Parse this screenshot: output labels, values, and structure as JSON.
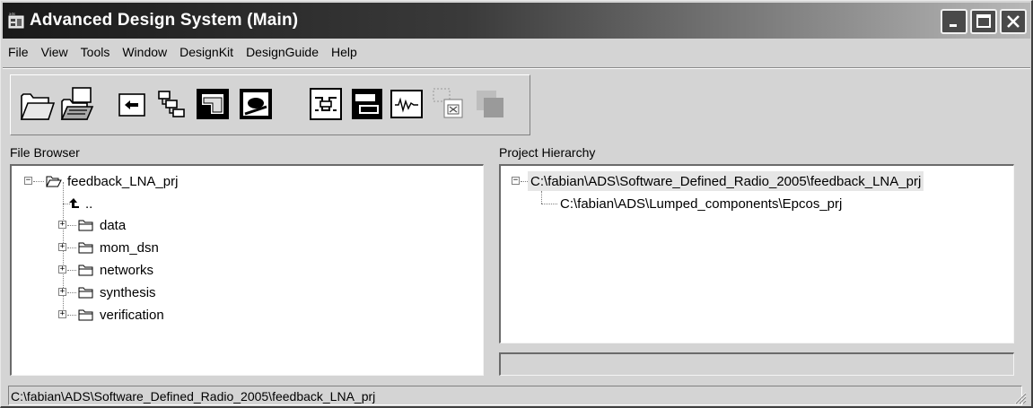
{
  "window": {
    "title": "Advanced Design System (Main)",
    "controls": [
      "minimize",
      "maximize",
      "close"
    ]
  },
  "menu": {
    "items": [
      "File",
      "View",
      "Tools",
      "Window",
      "DesignKit",
      "DesignGuide",
      "Help"
    ]
  },
  "toolbar": {
    "buttons": [
      {
        "name": "open-project",
        "icon": "folder-open-icon"
      },
      {
        "name": "open-design",
        "icon": "open-file-icon"
      },
      {
        "name": "return-up",
        "icon": "return-icon"
      },
      {
        "name": "hierarchy",
        "icon": "hierarchy-icon"
      },
      {
        "name": "new-layout",
        "icon": "layout-icon"
      },
      {
        "name": "new-schematic",
        "icon": "schematic-icon"
      },
      {
        "name": "schematic-window",
        "icon": "circuit-icon"
      },
      {
        "name": "layout-window",
        "icon": "layout-window-icon"
      },
      {
        "name": "data-display",
        "icon": "waveform-icon"
      },
      {
        "name": "close-window",
        "icon": "close-window-icon"
      },
      {
        "name": "tile-windows",
        "icon": "tile-icon"
      }
    ]
  },
  "file_browser": {
    "label": "File Browser",
    "root": "feedback_LNA_prj",
    "parent_link": "..",
    "folders": [
      "data",
      "mom_dsn",
      "networks",
      "synthesis",
      "verification"
    ]
  },
  "project_hierarchy": {
    "label": "Project Hierarchy",
    "root": "C:\\fabian\\ADS\\Software_Defined_Radio_2005\\feedback_LNA_prj",
    "child": "C:\\fabian\\ADS\\Lumped_components\\Epcos_prj"
  },
  "status": {
    "path": "C:\\fabian\\ADS\\Software_Defined_Radio_2005\\feedback_LNA_prj"
  }
}
